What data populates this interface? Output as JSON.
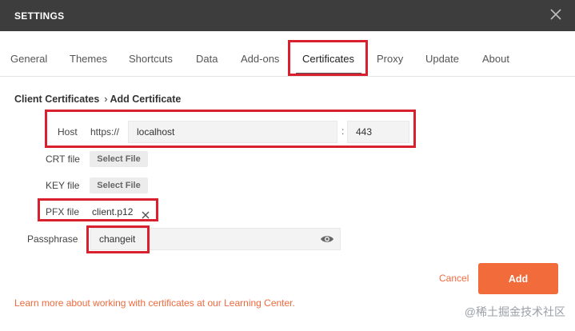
{
  "window": {
    "title": "SETTINGS"
  },
  "tabs": [
    {
      "label": "General"
    },
    {
      "label": "Themes"
    },
    {
      "label": "Shortcuts"
    },
    {
      "label": "Data"
    },
    {
      "label": "Add-ons"
    },
    {
      "label": "Certificates"
    },
    {
      "label": "Proxy"
    },
    {
      "label": "Update"
    },
    {
      "label": "About"
    }
  ],
  "breadcrumb": {
    "parent": "Client Certificates",
    "separator": "›",
    "current": "Add Certificate"
  },
  "form": {
    "host_label": "Host",
    "protocol": "https://",
    "host_value": "localhost",
    "port_separator": ":",
    "port_value": "443",
    "crt_label": "CRT file",
    "crt_button": "Select File",
    "key_label": "KEY file",
    "key_button": "Select File",
    "pfx_label": "PFX file",
    "pfx_file": "client.p12",
    "passphrase_label": "Passphrase",
    "passphrase_value": "changeit"
  },
  "actions": {
    "cancel": "Cancel",
    "add": "Add"
  },
  "footer": {
    "learn_more": "Learn more about working with certificates at our Learning Center."
  },
  "watermark": "@稀土掘金技术社区",
  "colors": {
    "titlebar": "#3d3d3d",
    "accent": "#f26b3a",
    "highlight": "#d8202e"
  }
}
